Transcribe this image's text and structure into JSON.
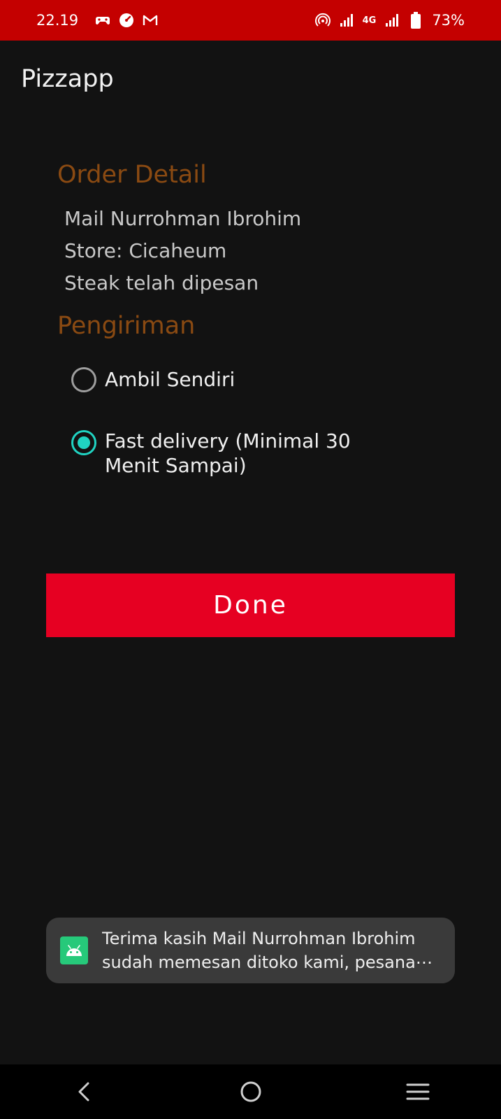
{
  "status_bar": {
    "time": "22.19",
    "network": "4G",
    "battery": "73%",
    "left_icons": [
      "game-controller-icon",
      "speed-icon",
      "gmail-icon"
    ],
    "right_icons": [
      "hotspot-icon",
      "signal-icon",
      "signal-icon",
      "battery-icon"
    ]
  },
  "app_bar": {
    "title": "Pizzapp"
  },
  "order_detail": {
    "heading": "Order Detail",
    "name": "Mail Nurrohman Ibrohim",
    "store": "Store: Cicaheum",
    "item": "Steak telah dipesan"
  },
  "shipping": {
    "heading": "Pengiriman",
    "options": [
      {
        "label": "Ambil Sendiri",
        "selected": false
      },
      {
        "label": "Fast delivery (Minimal 30 Menit Sampai)",
        "selected": true
      }
    ]
  },
  "done_button": {
    "label": "Done"
  },
  "toast": {
    "line1": "Terima kasih Mail Nurrohman Ibrohim",
    "line2": "sudah memesan ditoko kami, pesana⋯",
    "icon": "android-icon"
  },
  "nav_bar": {
    "buttons": [
      "back-icon",
      "home-icon",
      "recents-icon"
    ]
  },
  "colors": {
    "status_bar": "#c40000",
    "background": "#121212",
    "heading": "#8a4a12",
    "accent": "#20d3c2",
    "button": "#e60022"
  }
}
